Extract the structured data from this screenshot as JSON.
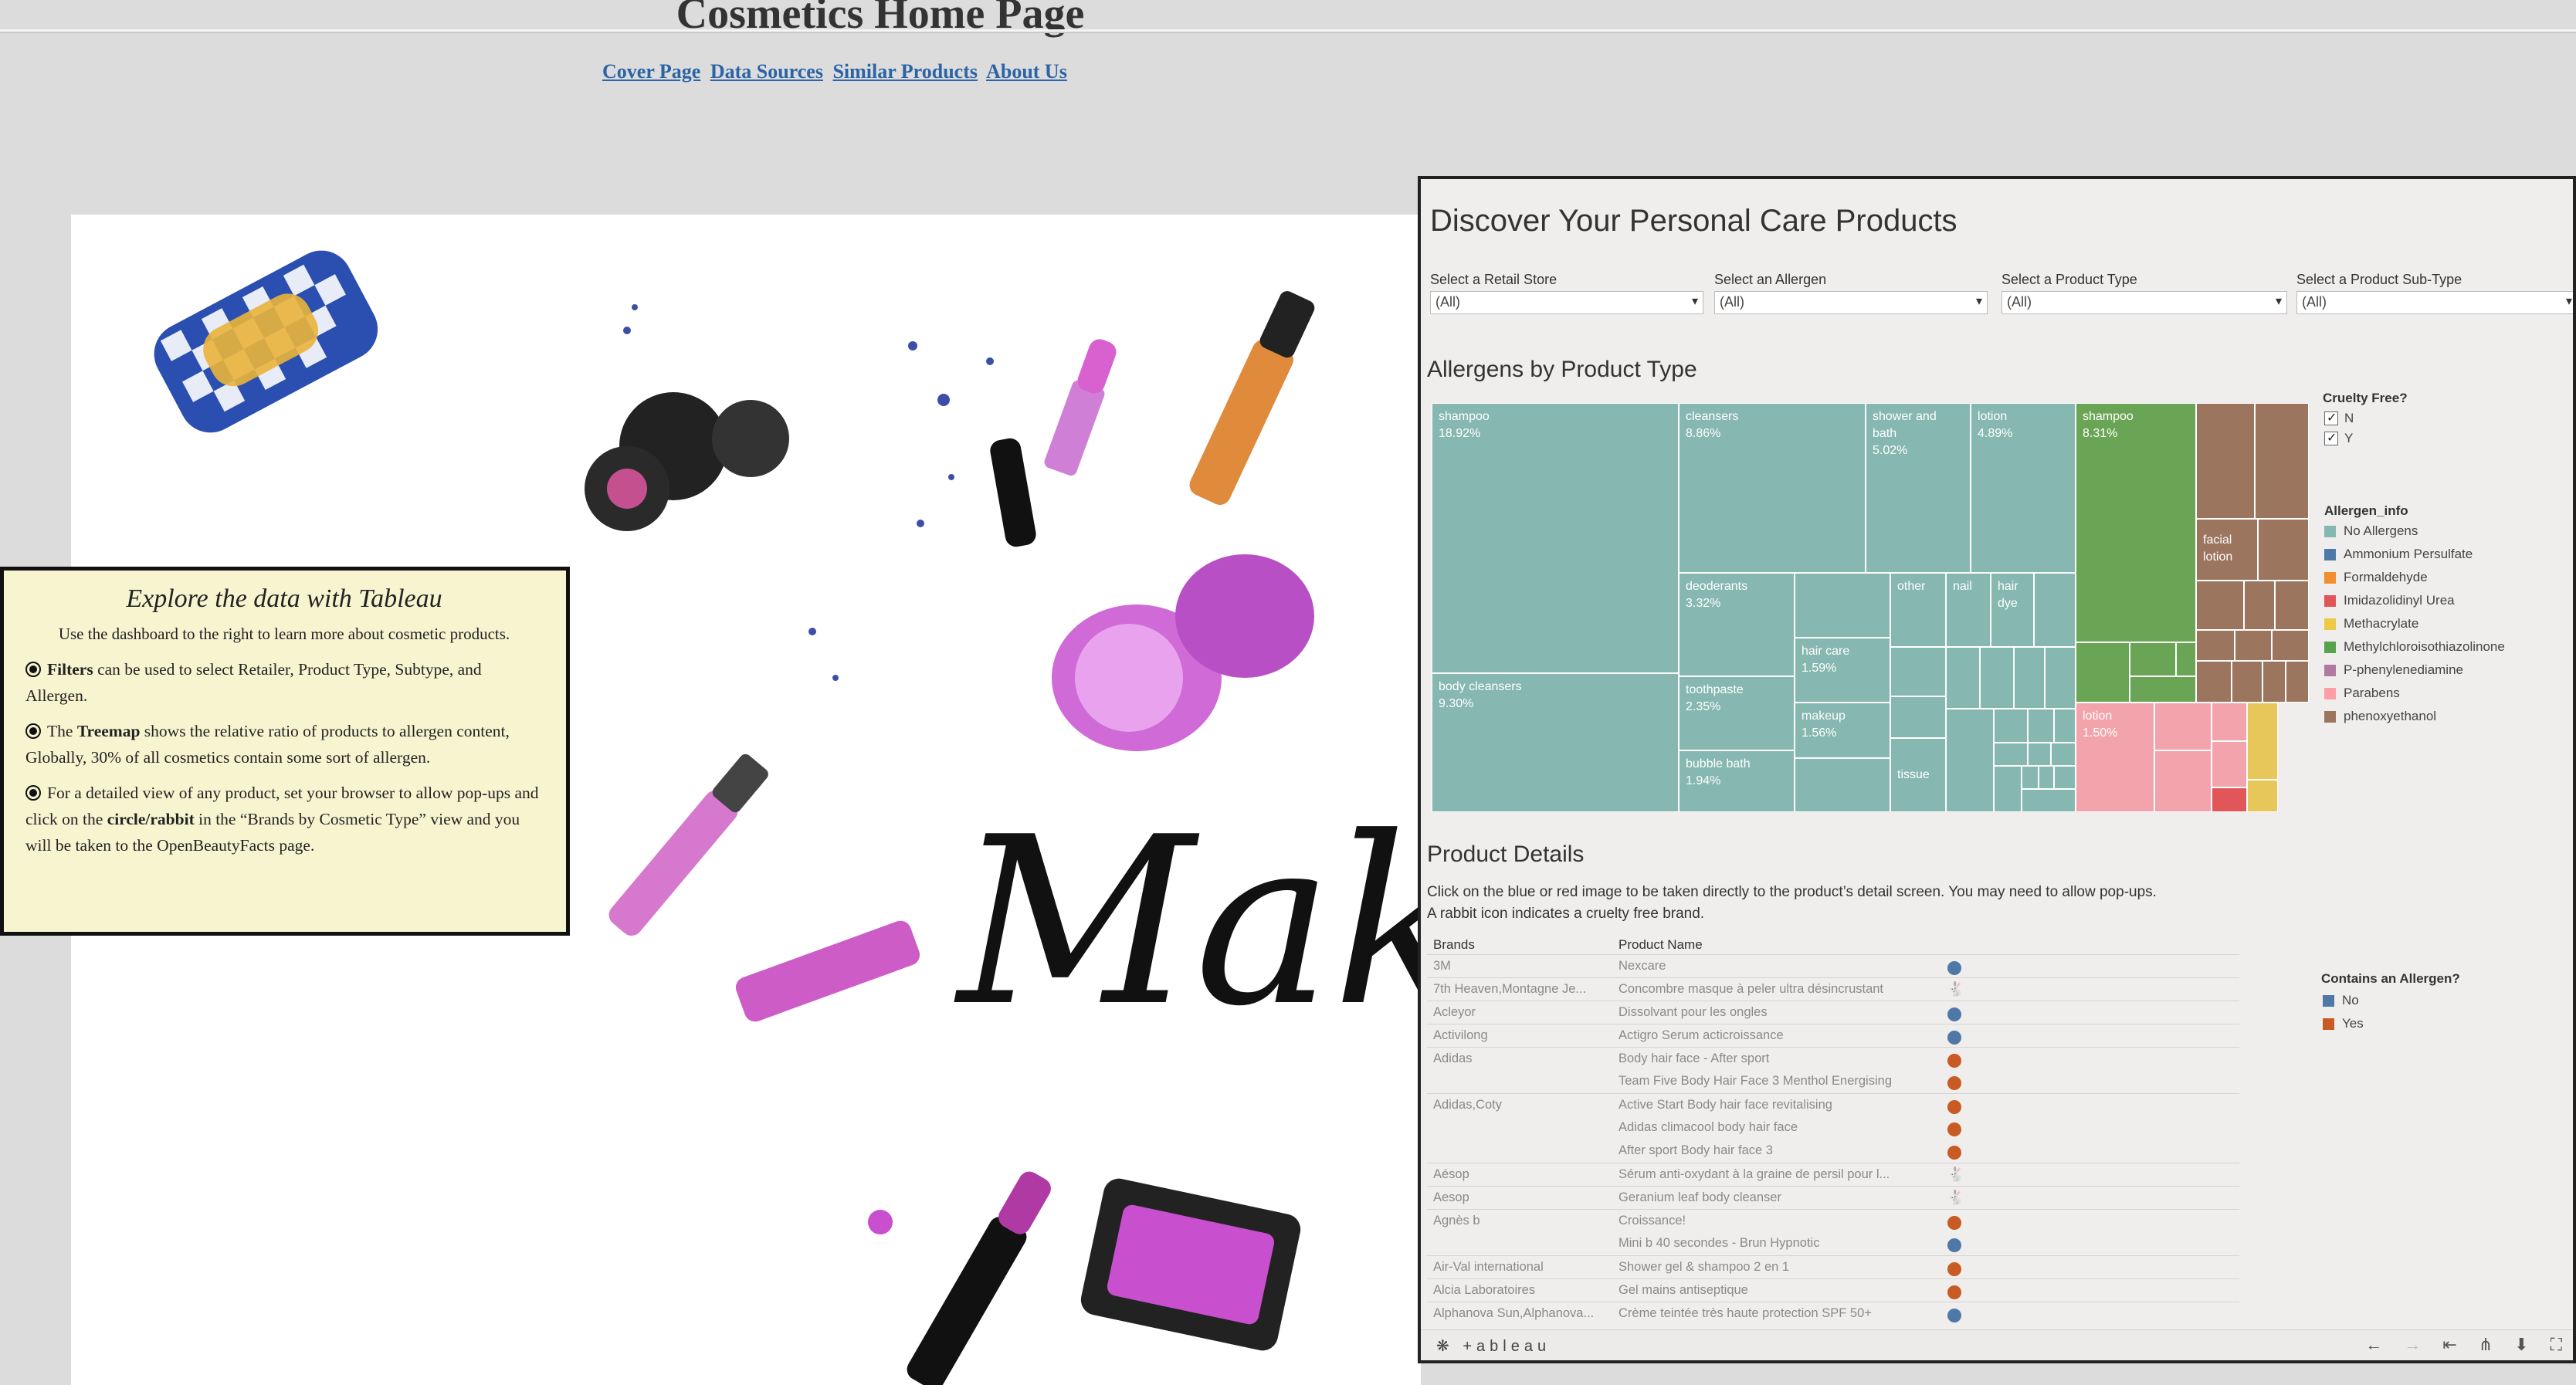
{
  "page": {
    "title": "Cosmetics Home Page",
    "nav": [
      "Cover Page",
      "Data Sources",
      "Similar Products",
      "About Us"
    ],
    "hero_text": "Makeu"
  },
  "explore": {
    "heading": "Explore the data with Tableau",
    "intro": "Use the dashboard to the right to learn more about cosmetic products.",
    "items": [
      {
        "bold": "Filters",
        "text": " can be used to select Retailer, Product Type, Subtype, and Allergen."
      },
      {
        "pre": "The ",
        "bold": "Treemap",
        "text": " shows the relative ratio of products to allergen content, Globally, 30% of all cosmetics contain some sort of allergen."
      },
      {
        "pre": "For a detailed view of any product, set your browser to allow pop-ups and click on the ",
        "bold": "circle/rabbit",
        "text": " in the “Brands by Cosmetic Type” view and you will be taken to the OpenBeautyFacts page."
      }
    ]
  },
  "dashboard": {
    "title": "Discover Your Personal Care Products",
    "filters": [
      {
        "label": "Select a Retail Store",
        "value": "(All)"
      },
      {
        "label": "Select an Allergen",
        "value": "(All)"
      },
      {
        "label": "Select a Product Type",
        "value": "(All)"
      },
      {
        "label": "Select a Product Sub-Type",
        "value": "(All)"
      }
    ],
    "treemap_title": "Allergens by Product Type",
    "cruelty_free": {
      "title": "Cruelty Free?",
      "options": [
        "N",
        "Y"
      ]
    },
    "allergen_legend": {
      "title": "Allergen_info",
      "items": [
        {
          "name": "No Allergens",
          "color": "#86b8b1"
        },
        {
          "name": "Ammonium Persulfate",
          "color": "#4e79a7"
        },
        {
          "name": "Formaldehyde",
          "color": "#f28e2b"
        },
        {
          "name": "Imidazolidinyl Urea",
          "color": "#e15759"
        },
        {
          "name": "Methacrylate",
          "color": "#edc948"
        },
        {
          "name": "Methylchloroisothiazolinone",
          "color": "#59a14f"
        },
        {
          "name": "P-phenylenediamine",
          "color": "#b07aa1"
        },
        {
          "name": "Parabens",
          "color": "#ff9da7"
        },
        {
          "name": "phenoxyethanol",
          "color": "#9c755f"
        }
      ]
    },
    "product_details_title": "Product Details",
    "product_details_desc": [
      "Click on the blue or red image to be taken directly to the product’s detail screen.  You may need to allow pop-ups.",
      "A rabbit icon indicates a cruelty free brand."
    ],
    "table_headers": {
      "brands": "Brands",
      "product": "Product Name"
    },
    "allergen_contains": {
      "title": "Contains an Allergen?",
      "items": [
        {
          "name": "No",
          "color": "#4e79a7"
        },
        {
          "name": "Yes",
          "color": "#c85a24"
        }
      ]
    },
    "rows": [
      {
        "brand": "3M",
        "product": "Nexcare",
        "marker": "dot",
        "color": "#4e79a7",
        "sep": true
      },
      {
        "brand": "7th Heaven,Montagne Je...",
        "product": "Concombre masque à peler ultra désincrustant",
        "marker": "rabbit",
        "color": "#c85a24",
        "sep": true
      },
      {
        "brand": "Acleyor",
        "product": "Dissolvant pour les ongles",
        "marker": "dot",
        "color": "#4e79a7",
        "sep": true
      },
      {
        "brand": "Activilong",
        "product": "Actigro Serum acticroissance",
        "marker": "dot",
        "color": "#4e79a7",
        "sep": true
      },
      {
        "brand": "Adidas",
        "product": "Body hair face - After sport",
        "marker": "dot",
        "color": "#c85a24",
        "sep": true
      },
      {
        "brand": "",
        "product": "Team Five Body Hair Face 3 Menthol Energising",
        "marker": "dot",
        "color": "#c85a24",
        "sep": false
      },
      {
        "brand": "Adidas,Coty",
        "product": "Active Start Body hair face revitalising",
        "marker": "dot",
        "color": "#c85a24",
        "sep": true
      },
      {
        "brand": "",
        "product": "Adidas climacool body hair face",
        "marker": "dot",
        "color": "#c85a24",
        "sep": false
      },
      {
        "brand": "",
        "product": "After sport Body hair face 3",
        "marker": "dot",
        "color": "#c85a24",
        "sep": false
      },
      {
        "brand": "Aésop",
        "product": "Sérum anti-oxydant à la graine de persil pour l...",
        "marker": "rabbit",
        "color": "#c85a24",
        "sep": true
      },
      {
        "brand": "Aesop",
        "product": "Geranium leaf body cleanser",
        "marker": "rabbit",
        "color": "#4e79a7",
        "sep": true
      },
      {
        "brand": "Agnès b",
        "product": "Croissance!",
        "marker": "dot",
        "color": "#c85a24",
        "sep": true
      },
      {
        "brand": "",
        "product": "Mini b 40 secondes - Brun Hypnotic",
        "marker": "dot",
        "color": "#4e79a7",
        "sep": false
      },
      {
        "brand": "Air-Val international",
        "product": "Shower gel & shampoo 2 en 1",
        "marker": "dot",
        "color": "#c85a24",
        "sep": true
      },
      {
        "brand": "Alcia Laboratoires",
        "product": "Gel mains antiseptique",
        "marker": "dot",
        "color": "#c85a24",
        "sep": true
      },
      {
        "brand": "Alphanova Sun,Alphanova...",
        "product": "Crème teintée très haute protection SPF 50+",
        "marker": "dot",
        "color": "#4e79a7",
        "sep": true
      }
    ],
    "footer_logo": "+ableau",
    "chart_data": {
      "type": "heatmap",
      "title": "Allergens by Product Type",
      "cells": [
        {
          "label": "shampoo",
          "value": "18.92%",
          "allergen": "No Allergens"
        },
        {
          "label": "cleansers",
          "value": "8.86%",
          "allergen": "No Allergens"
        },
        {
          "label": "shower and bath",
          "value": "5.02%",
          "allergen": "No Allergens"
        },
        {
          "label": "lotion",
          "value": "4.89%",
          "allergen": "No Allergens"
        },
        {
          "label": "body cleansers",
          "value": "9.30%",
          "allergen": "No Allergens"
        },
        {
          "label": "deoderants",
          "value": "3.32%",
          "allergen": "No Allergens"
        },
        {
          "label": "toothpaste",
          "value": "2.35%",
          "allergen": "No Allergens"
        },
        {
          "label": "bubble bath",
          "value": "1.94%",
          "allergen": "No Allergens"
        },
        {
          "label": "hair care",
          "value": "1.59%",
          "allergen": "No Allergens"
        },
        {
          "label": "makeup",
          "value": "1.56%",
          "allergen": "No Allergens"
        },
        {
          "label": "other",
          "value": "",
          "allergen": "No Allergens"
        },
        {
          "label": "nail",
          "value": "",
          "allergen": "No Allergens"
        },
        {
          "label": "hair dye",
          "value": "",
          "allergen": "No Allergens"
        },
        {
          "label": "tissue",
          "value": "",
          "allergen": "No Allergens"
        },
        {
          "label": "shampoo",
          "value": "8.31%",
          "allergen": "Methylchloroisothiazolinone"
        },
        {
          "label": "facial lotion",
          "value": "",
          "allergen": "phenoxyethanol"
        },
        {
          "label": "lotion",
          "value": "1.50%",
          "allergen": "Parabens"
        }
      ]
    }
  }
}
